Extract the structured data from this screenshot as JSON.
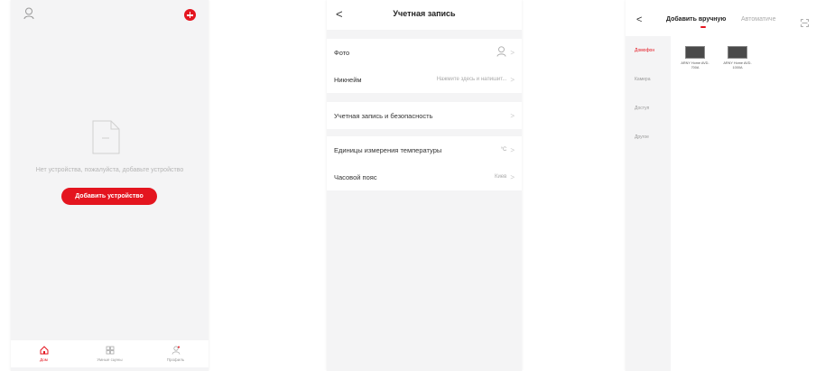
{
  "screen1": {
    "empty_text": "Нет устройства, пожалуйста, добавьте устройство",
    "add_button": "Добавить устройство",
    "tabs": [
      {
        "label": "Дом",
        "icon": "home-icon",
        "active": true
      },
      {
        "label": "Умные сцены",
        "icon": "scenes-icon",
        "active": false
      },
      {
        "label": "Профиль",
        "icon": "profile-icon",
        "active": false
      }
    ]
  },
  "screen2": {
    "title": "Учетная запись",
    "back": "<",
    "rows": {
      "photo": "Фото",
      "nickname": "Никнейм",
      "nickname_value": "Нажмите здесь и напишит...",
      "account_security": "Учетная запись и безопасность",
      "temp_units": "Единицы измерения температуры",
      "temp_units_value": "°C",
      "timezone": "Часовой пояс",
      "timezone_value": "Киев"
    },
    "chevron": ">"
  },
  "screen3": {
    "back": "<",
    "tab_manual": "Добавить вручную",
    "tab_auto": "Автоматиче",
    "categories": [
      "Домофон",
      "Камера",
      "Доступ",
      "Другое"
    ],
    "products": [
      {
        "name": "ARNY Home AVD-700A"
      },
      {
        "name": "ARNY Home AVD-1000A"
      }
    ]
  },
  "colors": {
    "accent": "#e4151f",
    "background": "#f4f4f5"
  }
}
